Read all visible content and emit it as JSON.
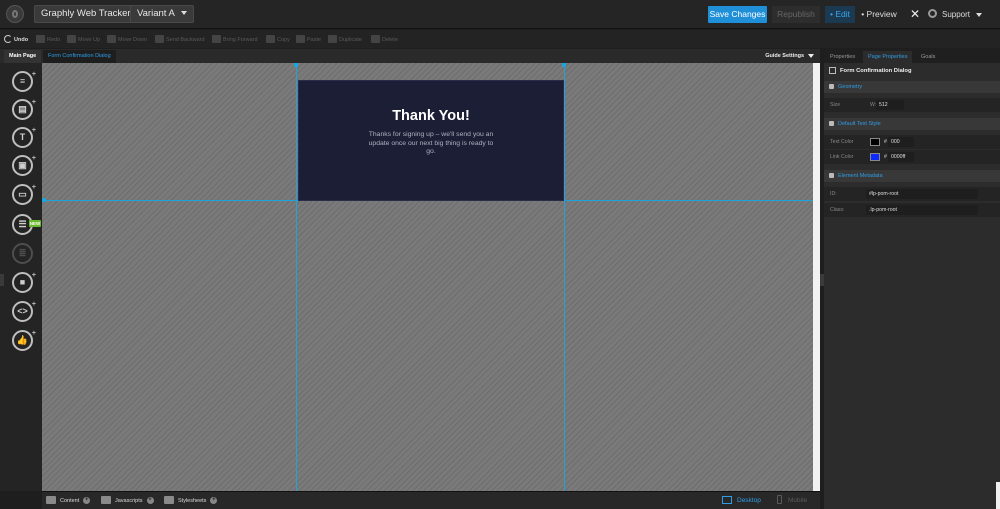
{
  "topbar": {
    "app_title": "Graphly Web Tracker",
    "variant": "Variant A",
    "save": "Save Changes",
    "republish": "Republish",
    "edit": "• Edit",
    "preview": "• Preview",
    "close": "✕",
    "support": "Support"
  },
  "toolbar": {
    "undo": "Undo",
    "redo": "Redo",
    "move_up": "Move Up",
    "move_down": "Move Down",
    "send_backward": "Send Backward",
    "bring_forward": "Bring Forward",
    "copy": "Copy",
    "paste": "Paste",
    "duplicate": "Duplicate",
    "delete": "Delete"
  },
  "tabs": {
    "main": "Main Page",
    "dialog": "Form Confirmation Dialog",
    "guide_settings": "Guide Settings"
  },
  "left_tools": {
    "new_badge": "NEW"
  },
  "dialog": {
    "title": "Thank You!",
    "body": "Thanks for signing up – we'll send you an update once our next big thing is ready to go."
  },
  "bottom": {
    "content": "Content",
    "javascripts": "Javascripts",
    "stylesheets": "Stylesheets",
    "desktop": "Desktop",
    "mobile": "Mobile"
  },
  "right_panel": {
    "tabs": [
      "Properties",
      "Page Properties",
      "Goals"
    ],
    "header": "Form Confirmation Dialog",
    "geometry": {
      "title": "Geometry",
      "size_label": "Size",
      "w_label": "W:",
      "w_value": "512"
    },
    "text_style": {
      "title": "Default Text Style",
      "text_color_label": "Text Color",
      "text_color_value": "000",
      "text_color_hex": "#000000",
      "link_color_label": "Link Color",
      "link_color_value": "0000ff",
      "link_color_hex": "#0000ff"
    },
    "metadata": {
      "title": "Element Metadata",
      "id_label": "ID:",
      "id_value": "#lp-pom-root",
      "class_label": "Class:",
      "class_value": ".lp-pom-root"
    }
  },
  "colors": {
    "accent": "#1f8fd8",
    "dialog_bg": "#1c1e36",
    "guide": "#1ea4dc"
  }
}
